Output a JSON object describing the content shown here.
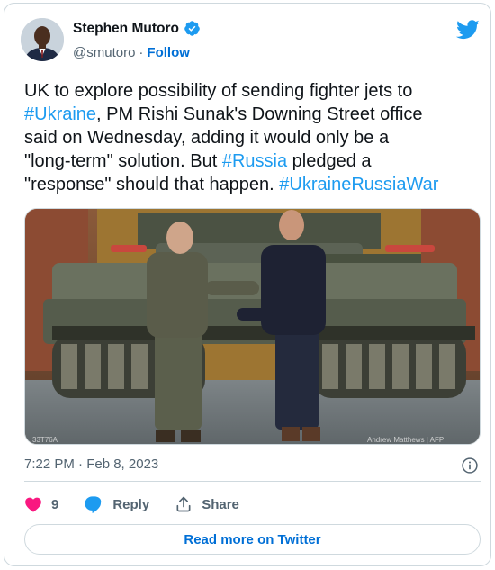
{
  "author": {
    "name": "Stephen Mutoro",
    "handle": "@smutoro",
    "separator": "·",
    "follow_label": "Follow",
    "verified": true
  },
  "tweet": {
    "segments": [
      {
        "text": "UK to explore possibility of sending fighter jets to\n",
        "type": "text"
      },
      {
        "text": "#Ukraine",
        "type": "hashtag"
      },
      {
        "text": ", PM Rishi Sunak's Downing Street office\nsaid on Wednesday, adding it would only be a\n\"long-term\" solution. But ",
        "type": "text"
      },
      {
        "text": "#Russia",
        "type": "hashtag"
      },
      {
        "text": " pledged a\n\"response\" should that happen. ",
        "type": "text"
      },
      {
        "text": "#UkraineRussiaWar",
        "type": "hashtag"
      }
    ]
  },
  "media": {
    "photo_credit": "Andrew Matthews | AFP",
    "photo_id": "33T76A"
  },
  "timestamp": "7:22 PM · Feb 8, 2023",
  "actions": {
    "like_count": "9",
    "reply_label": "Reply",
    "share_label": "Share"
  },
  "read_more_label": "Read more on Twitter",
  "colors": {
    "accent": "#1d9bf0",
    "link": "#006fd6",
    "like": "#f91880",
    "muted": "#536471",
    "border": "#cfd9de"
  },
  "icons": [
    "verified-badge-icon",
    "twitter-bird-icon",
    "info-icon",
    "heart-icon",
    "reply-bubble-icon",
    "share-icon"
  ]
}
